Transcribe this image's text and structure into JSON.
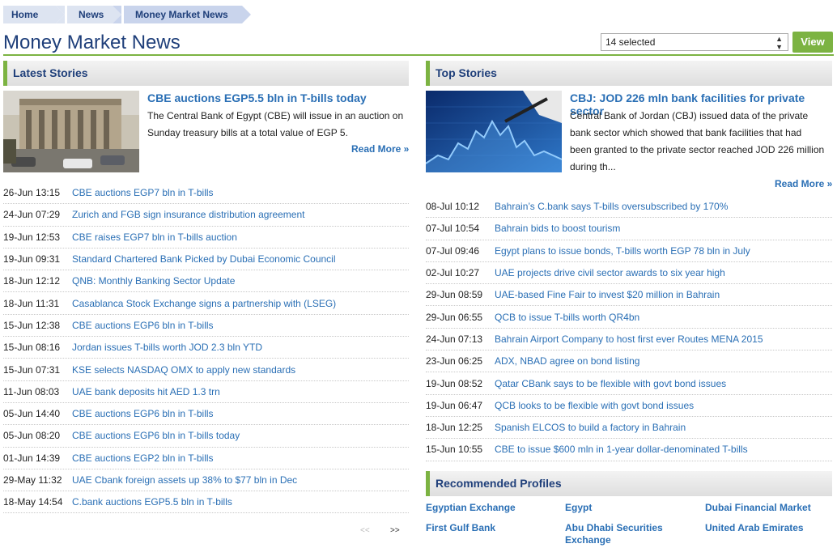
{
  "breadcrumb": [
    "Home",
    "News",
    "Money Market News"
  ],
  "page_title": "Money Market News",
  "selector": {
    "value": "14 selected",
    "button": "View"
  },
  "latest": {
    "header": "Latest Stories",
    "featured": {
      "title": "CBE auctions EGP5.5 bln in T-bills today",
      "lines": [
        "The Central Bank of Egypt (CBE) will issue in an auction on",
        "Sunday treasury bills at a total value of EGP 5."
      ],
      "read_more": "Read More »"
    },
    "items": [
      {
        "date": "26-Jun 13:15",
        "title": "CBE auctions EGP7 bln in T-bills"
      },
      {
        "date": "24-Jun 07:29",
        "title": "Zurich and FGB sign insurance distribution agreement"
      },
      {
        "date": "19-Jun 12:53",
        "title": "CBE raises EGP7 bln in T-bills auction"
      },
      {
        "date": "19-Jun 09:31",
        "title": "Standard Chartered Bank Picked by Dubai Economic Council"
      },
      {
        "date": "18-Jun 12:12",
        "title": "QNB: Monthly Banking Sector Update"
      },
      {
        "date": "18-Jun 11:31",
        "title": "Casablanca Stock Exchange signs a partnership with (LSEG)"
      },
      {
        "date": "15-Jun 12:38",
        "title": "CBE auctions EGP6 bln in T-bills"
      },
      {
        "date": "15-Jun 08:16",
        "title": "Jordan issues T-bills worth JOD 2.3 bln YTD"
      },
      {
        "date": "15-Jun 07:31",
        "title": "KSE selects NASDAQ OMX to apply new standards"
      },
      {
        "date": "11-Jun 08:03",
        "title": "UAE bank deposits hit AED 1.3 trn"
      },
      {
        "date": "05-Jun 14:40",
        "title": "CBE auctions EGP6 bln in T-bills"
      },
      {
        "date": "05-Jun 08:20",
        "title": "CBE auctions EGP6 bln in T-bills today"
      },
      {
        "date": "01-Jun 14:39",
        "title": "CBE auctions EGP2 bln in T-bills"
      },
      {
        "date": "29-May 11:32",
        "title": "UAE Cbank foreign assets up 38% to $77 bln in Dec"
      },
      {
        "date": "18-May 14:54",
        "title": "C.bank auctions EGP5.5 bln in T-bills"
      }
    ],
    "pager": {
      "prev": "<<",
      "next": ">>"
    }
  },
  "top": {
    "header": "Top Stories",
    "featured": {
      "title": "CBJ: JOD 226 mln bank facilities for private sector",
      "lines": [
        "Central Bank of Jordan (CBJ) issued data of the private",
        "bank sector which showed that bank facilities that had",
        "been granted to the private sector reached JOD 226 million",
        "during th..."
      ],
      "read_more": "Read More »"
    },
    "items": [
      {
        "date": "08-Jul 10:12",
        "title": "Bahrain’s C.bank says T-bills oversubscribed by 170%"
      },
      {
        "date": "07-Jul 10:54",
        "title": "Bahrain bids to boost tourism"
      },
      {
        "date": "07-Jul 09:46",
        "title": "Egypt plans to issue bonds, T-bills worth EGP 78 bln in July"
      },
      {
        "date": "02-Jul 10:27",
        "title": "UAE projects drive civil sector awards to six year high"
      },
      {
        "date": "29-Jun 08:59",
        "title": "UAE-based Fine Fair to invest $20 million in Bahrain"
      },
      {
        "date": "29-Jun 06:55",
        "title": "QCB to issue T-bills worth QR4bn"
      },
      {
        "date": "24-Jun 07:13",
        "title": "Bahrain Airport Company to host first ever Routes MENA 2015"
      },
      {
        "date": "23-Jun 06:25",
        "title": "ADX, NBAD agree on bond listing"
      },
      {
        "date": "19-Jun 08:52",
        "title": "Qatar CBank says to be flexible with govt bond issues"
      },
      {
        "date": "19-Jun 06:47",
        "title": "QCB looks to be flexible with govt bond issues"
      },
      {
        "date": "18-Jun 12:25",
        "title": "Spanish ELCOS to build a factory in Bahrain"
      },
      {
        "date": "15-Jun 10:55",
        "title": "CBE to issue $600 mln in 1-year dollar-denominated T-bills"
      }
    ]
  },
  "profiles": {
    "header": "Recommended Profiles",
    "items": [
      "Egyptian Exchange",
      "Egypt",
      "Dubai Financial Market",
      "First Gulf Bank",
      "Abu Dhabi Securities Exchange",
      "United Arab Emirates"
    ]
  },
  "colors": {
    "accent_green": "#7cb342",
    "title_blue": "#1f3f7a",
    "link_blue": "#2a6fb5"
  }
}
